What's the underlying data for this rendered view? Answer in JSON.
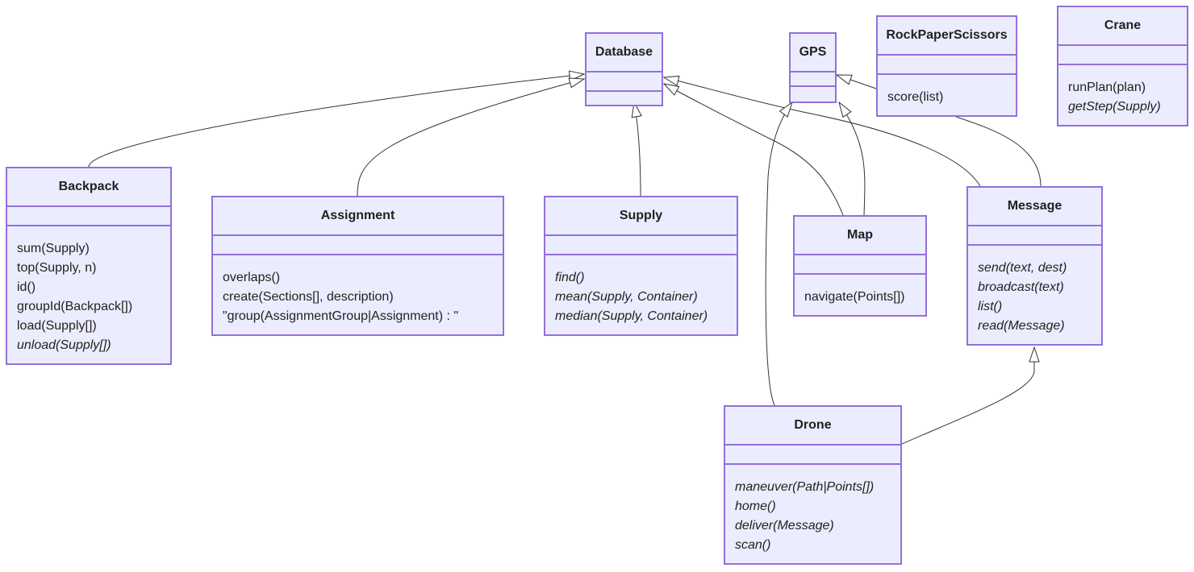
{
  "diagram": {
    "type": "class",
    "colors": {
      "fill": "#ECECFF",
      "border": "#9370DB",
      "edge": "#333333",
      "text": "#222222"
    },
    "classes": {
      "database": {
        "name": "Database",
        "methods": []
      },
      "gps": {
        "name": "GPS",
        "methods": []
      },
      "rockpaperscissors": {
        "name": "RockPaperScissors",
        "methods": [
          {
            "text": "score(list)",
            "abstract": false
          }
        ]
      },
      "crane": {
        "name": "Crane",
        "methods": [
          {
            "text": "runPlan(plan)",
            "abstract": false
          },
          {
            "text": "getStep(Supply)",
            "abstract": true
          }
        ]
      },
      "backpack": {
        "name": "Backpack",
        "methods": [
          {
            "text": "sum(Supply)",
            "abstract": false
          },
          {
            "text": "top(Supply, n)",
            "abstract": false
          },
          {
            "text": "id()",
            "abstract": false
          },
          {
            "text": "groupId(Backpack[])",
            "abstract": false
          },
          {
            "text": "load(Supply[])",
            "abstract": false
          },
          {
            "text": "unload(Supply[])",
            "abstract": true
          }
        ]
      },
      "assignment": {
        "name": "Assignment",
        "methods": [
          {
            "text": "overlaps()",
            "abstract": false
          },
          {
            "text": "create(Sections[], description)",
            "abstract": false
          },
          {
            "text": "\"group(AssignmentGroup|Assignment) : \"",
            "abstract": false
          }
        ]
      },
      "supply": {
        "name": "Supply",
        "methods": [
          {
            "text": "find()",
            "abstract": true
          },
          {
            "text": "mean(Supply, Container)",
            "abstract": true
          },
          {
            "text": "median(Supply, Container)",
            "abstract": true
          }
        ]
      },
      "map": {
        "name": "Map",
        "methods": [
          {
            "text": "navigate(Points[])",
            "abstract": false
          }
        ]
      },
      "message": {
        "name": "Message",
        "methods": [
          {
            "text": "send(text, dest)",
            "abstract": true
          },
          {
            "text": "broadcast(text)",
            "abstract": true
          },
          {
            "text": "list()",
            "abstract": true
          },
          {
            "text": "read(Message)",
            "abstract": true
          }
        ]
      },
      "drone": {
        "name": "Drone",
        "methods": [
          {
            "text": "maneuver(Path|Points[])",
            "abstract": true
          },
          {
            "text": "home()",
            "abstract": true
          },
          {
            "text": "deliver(Message)",
            "abstract": true
          },
          {
            "text": "scan()",
            "abstract": true
          }
        ]
      }
    },
    "relations": [
      {
        "from": "Backpack",
        "to": "Database",
        "type": "inheritance"
      },
      {
        "from": "Assignment",
        "to": "Database",
        "type": "inheritance"
      },
      {
        "from": "Supply",
        "to": "Database",
        "type": "inheritance"
      },
      {
        "from": "Map",
        "to": "Database",
        "type": "inheritance"
      },
      {
        "from": "Message",
        "to": "Database",
        "type": "inheritance"
      },
      {
        "from": "Map",
        "to": "GPS",
        "type": "inheritance"
      },
      {
        "from": "Drone",
        "to": "GPS",
        "type": "inheritance"
      },
      {
        "from": "Message",
        "to": "GPS",
        "type": "inheritance"
      },
      {
        "from": "Drone",
        "to": "Message",
        "type": "inheritance"
      }
    ]
  }
}
